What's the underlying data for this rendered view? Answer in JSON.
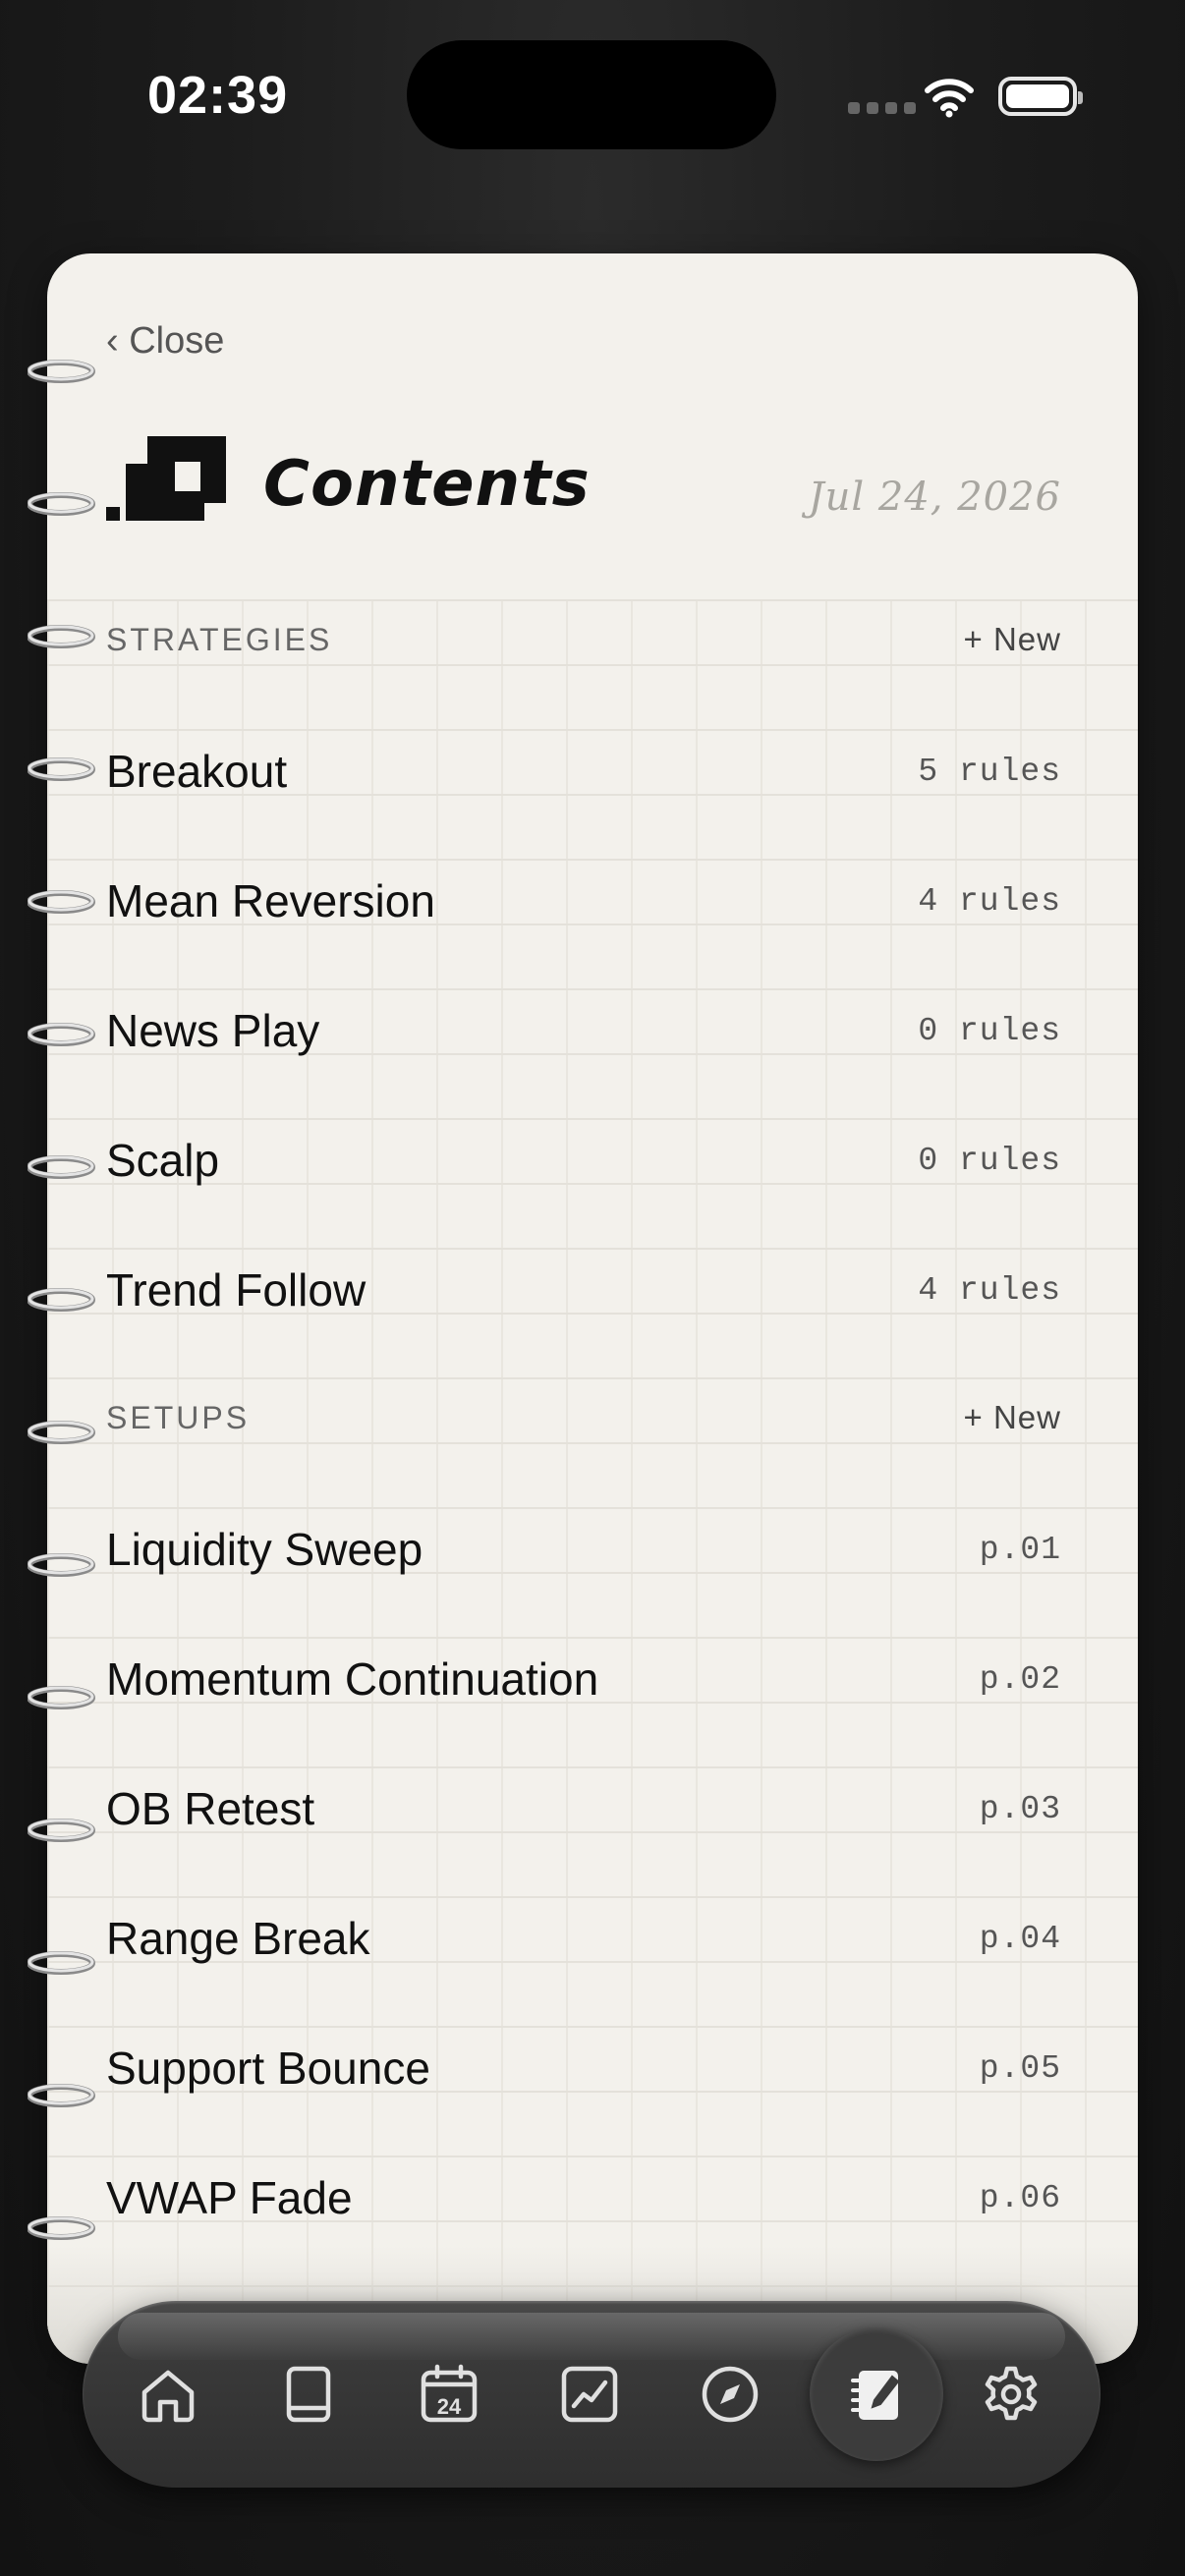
{
  "status_bar": {
    "time": "02:39"
  },
  "header": {
    "close_label": "‹ Close",
    "title": "Contents",
    "date": "Jul 24, 2026"
  },
  "strategies": {
    "section_title": "STRATEGIES",
    "new_label": "+ New",
    "items": [
      {
        "label": "Breakout",
        "meta": "5 rules"
      },
      {
        "label": "Mean Reversion",
        "meta": "4 rules"
      },
      {
        "label": "News Play",
        "meta": "0 rules"
      },
      {
        "label": "Scalp",
        "meta": "0 rules"
      },
      {
        "label": "Trend Follow",
        "meta": "4 rules"
      }
    ]
  },
  "setups": {
    "section_title": "SETUPS",
    "new_label": "+ New",
    "items": [
      {
        "label": "Liquidity Sweep",
        "meta": "p.01"
      },
      {
        "label": "Momentum Continuation",
        "meta": "p.02"
      },
      {
        "label": "OB Retest",
        "meta": "p.03"
      },
      {
        "label": "Range Break",
        "meta": "p.04"
      },
      {
        "label": "Support Bounce",
        "meta": "p.05"
      },
      {
        "label": "VWAP Fade",
        "meta": "p.06"
      }
    ]
  },
  "tab_bar": {
    "tabs": [
      {
        "icon": "home-icon"
      },
      {
        "icon": "book-icon"
      },
      {
        "icon": "calendar-icon",
        "badge": "24"
      },
      {
        "icon": "chart-icon"
      },
      {
        "icon": "compass-icon"
      },
      {
        "icon": "notebook-icon",
        "active": true
      },
      {
        "icon": "gear-icon"
      }
    ]
  },
  "colors": {
    "page_background": "#f3f1ec",
    "app_background": "#1c1c1c",
    "text_primary": "#111111",
    "text_muted": "#555555",
    "tab_icon": "#e0e0e0"
  }
}
